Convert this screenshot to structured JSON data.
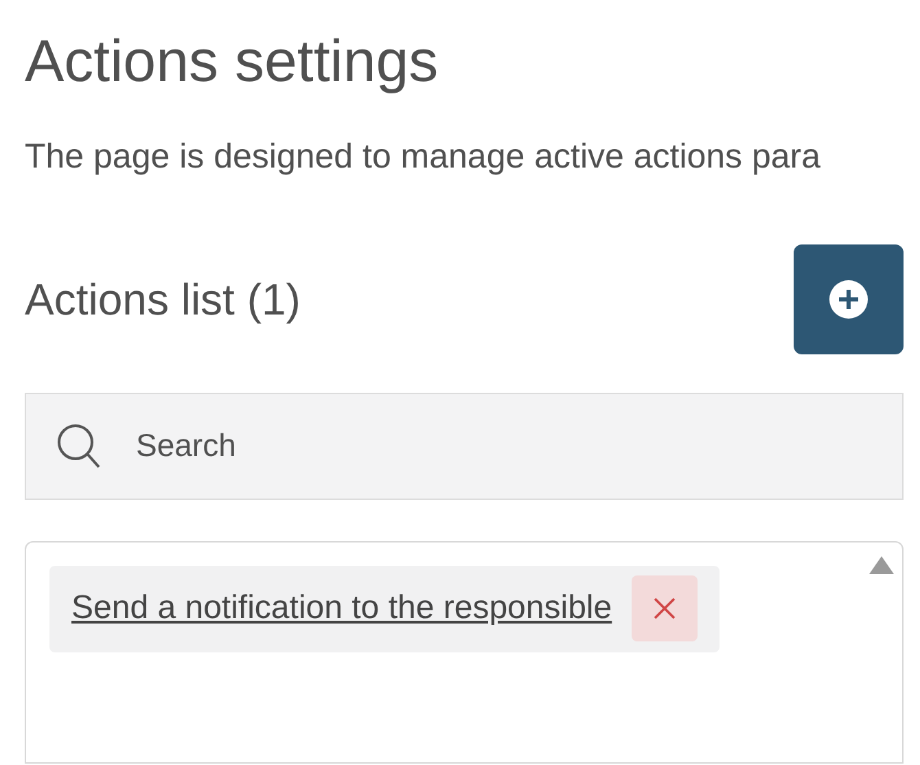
{
  "title": "Actions settings",
  "description": "The page is designed to manage active actions para",
  "actions_list": {
    "title": "Actions list (1)"
  },
  "search": {
    "placeholder": "Search"
  },
  "actions": [
    {
      "label": "Send a notification to the responsible"
    }
  ]
}
